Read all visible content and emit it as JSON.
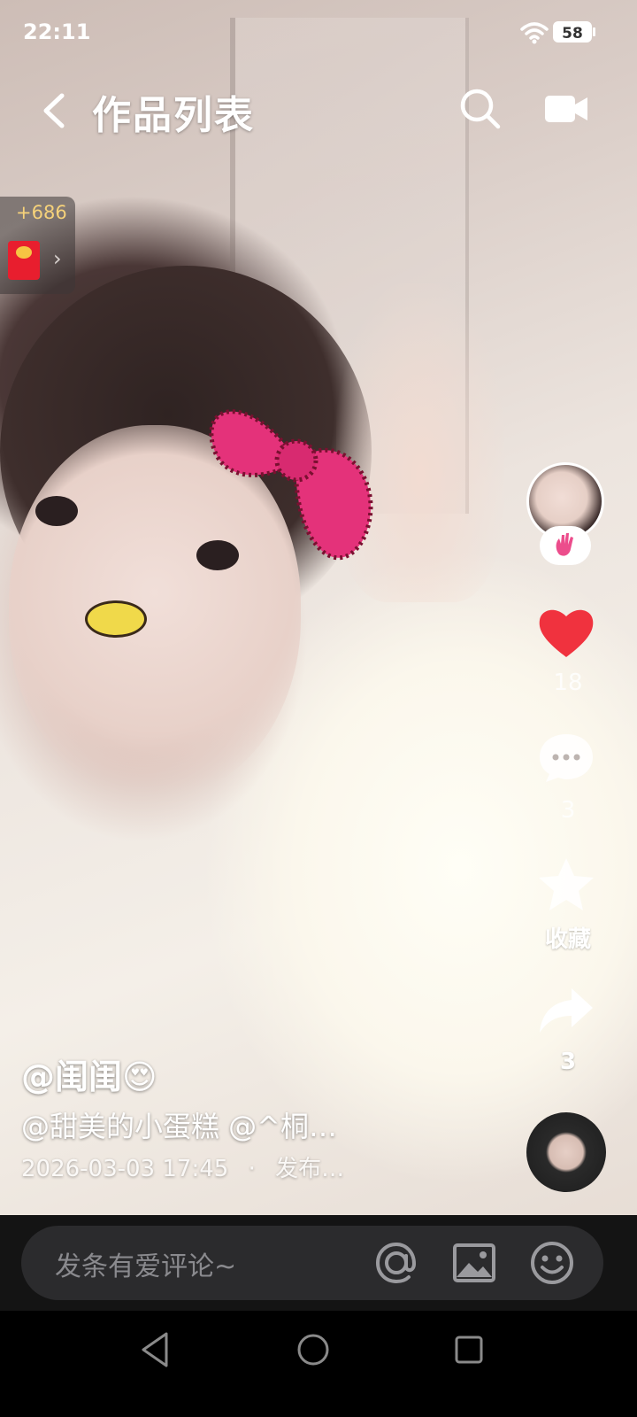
{
  "status_bar": {
    "time": "22:11",
    "battery": "58"
  },
  "header": {
    "title": "作品列表"
  },
  "red_packet": {
    "amount": "+686"
  },
  "actions": {
    "like_count": "18",
    "comment_count": "3",
    "favorite_label": "收藏",
    "share_count": "3"
  },
  "post": {
    "author": "@闺闺😍",
    "mentions": "@甜美的小蛋糕 @^桐…",
    "date": "2026-03-03  17:45",
    "separator": "·",
    "publish": "发布…"
  },
  "comment_bar": {
    "placeholder": "发条有爱评论~"
  },
  "colors": {
    "like": "#f0323e",
    "red_packet": "#e81e2e",
    "bar_bg": "#141414",
    "input_bg": "#2b2b2d"
  },
  "icons": [
    "back-icon",
    "search-icon",
    "camera-icon",
    "wifi-icon",
    "heart-icon",
    "comment-icon",
    "star-icon",
    "share-icon",
    "at-icon",
    "image-icon",
    "emoji-icon",
    "nav-back-icon",
    "nav-home-icon",
    "nav-recent-icon"
  ]
}
